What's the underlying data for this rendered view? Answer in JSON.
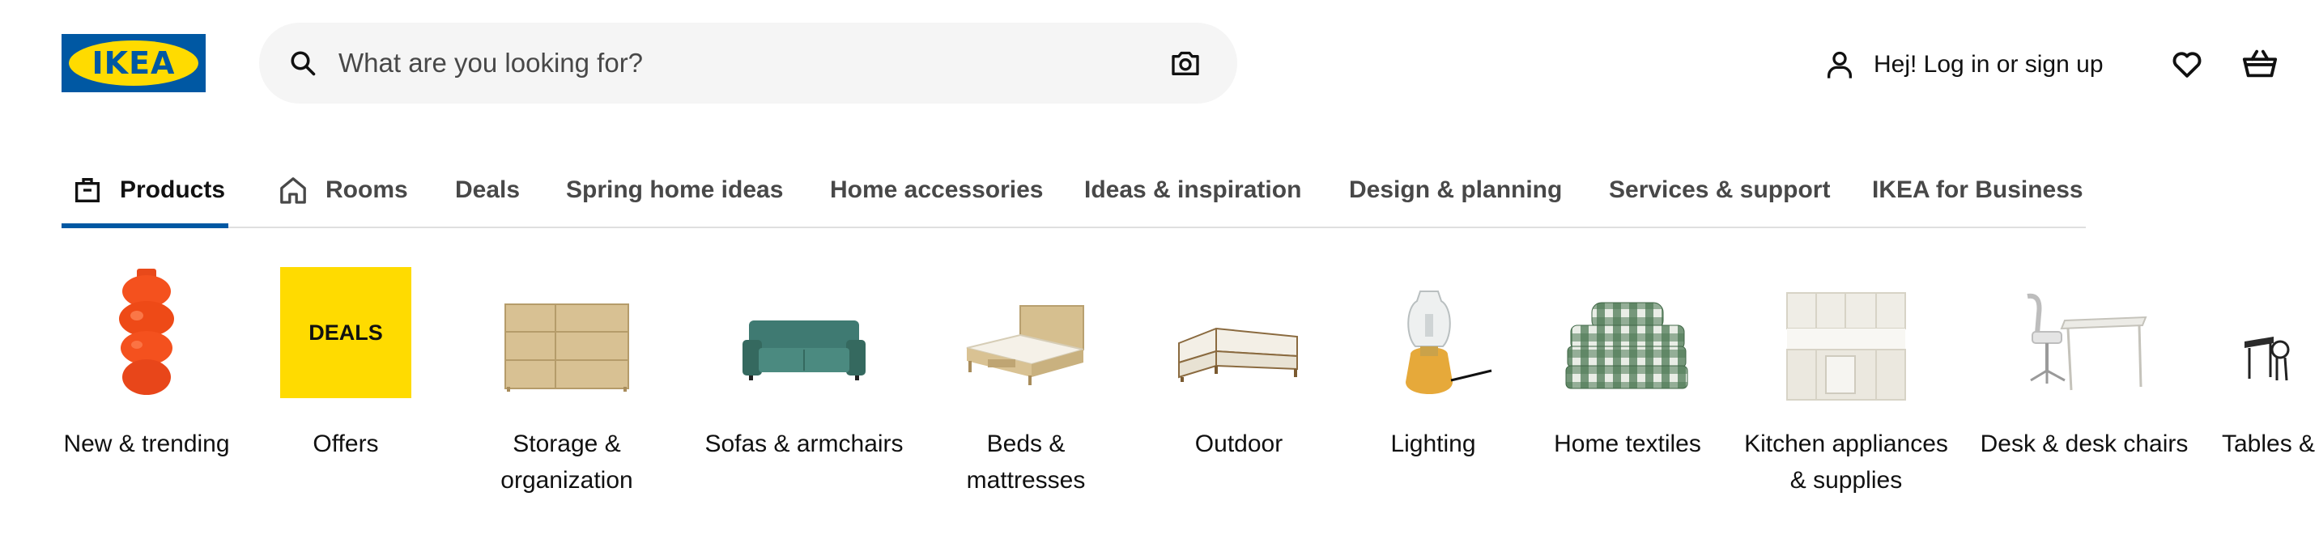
{
  "brand": {
    "logo_text": "IKEA",
    "primary_color": "#0058a3",
    "accent_color": "#ffdb00"
  },
  "search": {
    "placeholder": "What are you looking for?",
    "icon": "search-icon",
    "camera_icon": "camera-icon"
  },
  "account": {
    "login_label": "Hej! Log in or sign up",
    "user_icon": "user-icon",
    "favorites_icon": "heart-icon",
    "cart_icon": "basket-icon"
  },
  "tabs": [
    {
      "label": "Products",
      "icon": "products-bag-icon",
      "active": true
    },
    {
      "label": "Rooms",
      "icon": "house-icon",
      "active": false
    },
    {
      "label": "Deals",
      "active": false
    },
    {
      "label": "Spring home ideas",
      "active": false
    },
    {
      "label": "Home accessories",
      "active": false
    },
    {
      "label": "Ideas & inspiration",
      "active": false
    },
    {
      "label": "Design & planning",
      "active": false
    },
    {
      "label": "Services & support",
      "active": false
    },
    {
      "label": "IKEA for Business",
      "active": false
    }
  ],
  "categories": [
    {
      "label": "New & trending",
      "image": "orange-vase"
    },
    {
      "label": "Offers",
      "image": "deals-tile",
      "badge": "DEALS",
      "badge_color": "#ffdb00"
    },
    {
      "label": "Storage & organization",
      "image": "dresser"
    },
    {
      "label": "Sofas & armchairs",
      "image": "green-sofa"
    },
    {
      "label": "Beds & mattresses",
      "image": "bed"
    },
    {
      "label": "Outdoor",
      "image": "outdoor-sofa"
    },
    {
      "label": "Lighting",
      "image": "table-lamp"
    },
    {
      "label": "Home textiles",
      "image": "bedding-stack"
    },
    {
      "label": "Kitchen appliances & supplies",
      "image": "kitchen"
    },
    {
      "label": "Desk & desk chairs",
      "image": "desk-chair"
    },
    {
      "label": "Tables & chairs",
      "image": "table-chairs"
    }
  ],
  "carousel": {
    "scroll_progress": 0.44
  }
}
